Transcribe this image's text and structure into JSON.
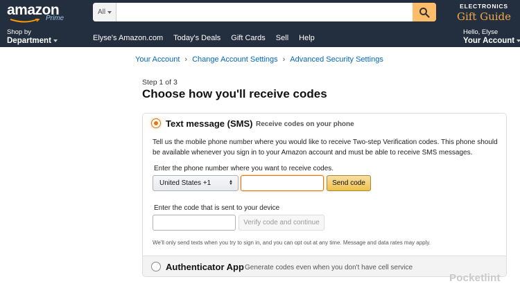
{
  "header": {
    "logo_text": "amazon",
    "logo_sub": "Prime",
    "search": {
      "category": "All",
      "placeholder": "",
      "value": ""
    },
    "promo": {
      "top": "ELECTRONICS",
      "main": "Gift Guide"
    }
  },
  "nav": {
    "shop_small": "Shop by",
    "shop_big": "Department",
    "links": [
      "Elyse's Amazon.com",
      "Today's Deals",
      "Gift Cards",
      "Sell",
      "Help"
    ],
    "account_small": "Hello, Elyse",
    "account_big": "Your Account"
  },
  "breadcrumb": [
    "Your Account",
    "Change Account Settings",
    "Advanced Security Settings"
  ],
  "breadcrumb_sep": "›",
  "step": "Step 1 of 3",
  "heading": "Choose how you'll receive codes",
  "sms": {
    "title": "Text message (SMS)",
    "subtitle": "Receive codes on your phone",
    "description": "Tell us the mobile phone number where you would like to receive Two-step Verification codes. This phone should be available whenever you sign in to your Amazon account and must be able to receive SMS messages.",
    "phone_label": "Enter the phone number where you want to receive codes.",
    "country": "United States +1",
    "phone_value": "",
    "send_button": "Send code",
    "code_label": "Enter the code that is sent to your device",
    "code_value": "",
    "verify_button": "Verify code and continue",
    "optout": "We'll only send texts when you try to sign in, and you can opt out at any time. Message and data rates may apply."
  },
  "authenticator": {
    "title": "Authenticator App",
    "subtitle": "Generate codes even when you don't have cell service"
  },
  "watermark": "Pocketlint",
  "colors": {
    "header_bg": "#232f3e",
    "search_button": "#febd69",
    "link": "#0066c0",
    "accent": "#e47911",
    "button_yellow": "#f0c14b"
  }
}
